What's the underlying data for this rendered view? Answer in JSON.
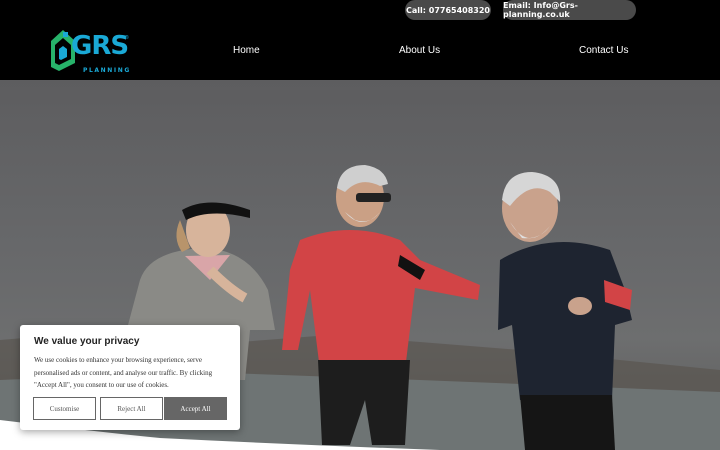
{
  "header": {
    "call_label": "Call: 07765408320",
    "email_label": "Email: Info@Grs-planning.co.uk",
    "logo": {
      "word": "GRS",
      "registered": "®",
      "sub": "PLANNING",
      "accent": "#1aa9d6"
    }
  },
  "nav": {
    "items": [
      {
        "label": "Home"
      },
      {
        "label": "About Us"
      },
      {
        "label": "Contact Us"
      }
    ]
  },
  "cookie": {
    "title": "We value your privacy",
    "text": "We use cookies to enhance your browsing experience, serve personalised ads or content, and analyse our traffic. By clicking \"Accept All\", you consent to our use of cookies.",
    "customise_label": "Customise",
    "reject_label": "Reject All",
    "accept_label": "Accept All"
  },
  "colors": {
    "header_bg": "#000000",
    "pill_bg": "#4a4a4a",
    "accept_bg": "#666666"
  }
}
